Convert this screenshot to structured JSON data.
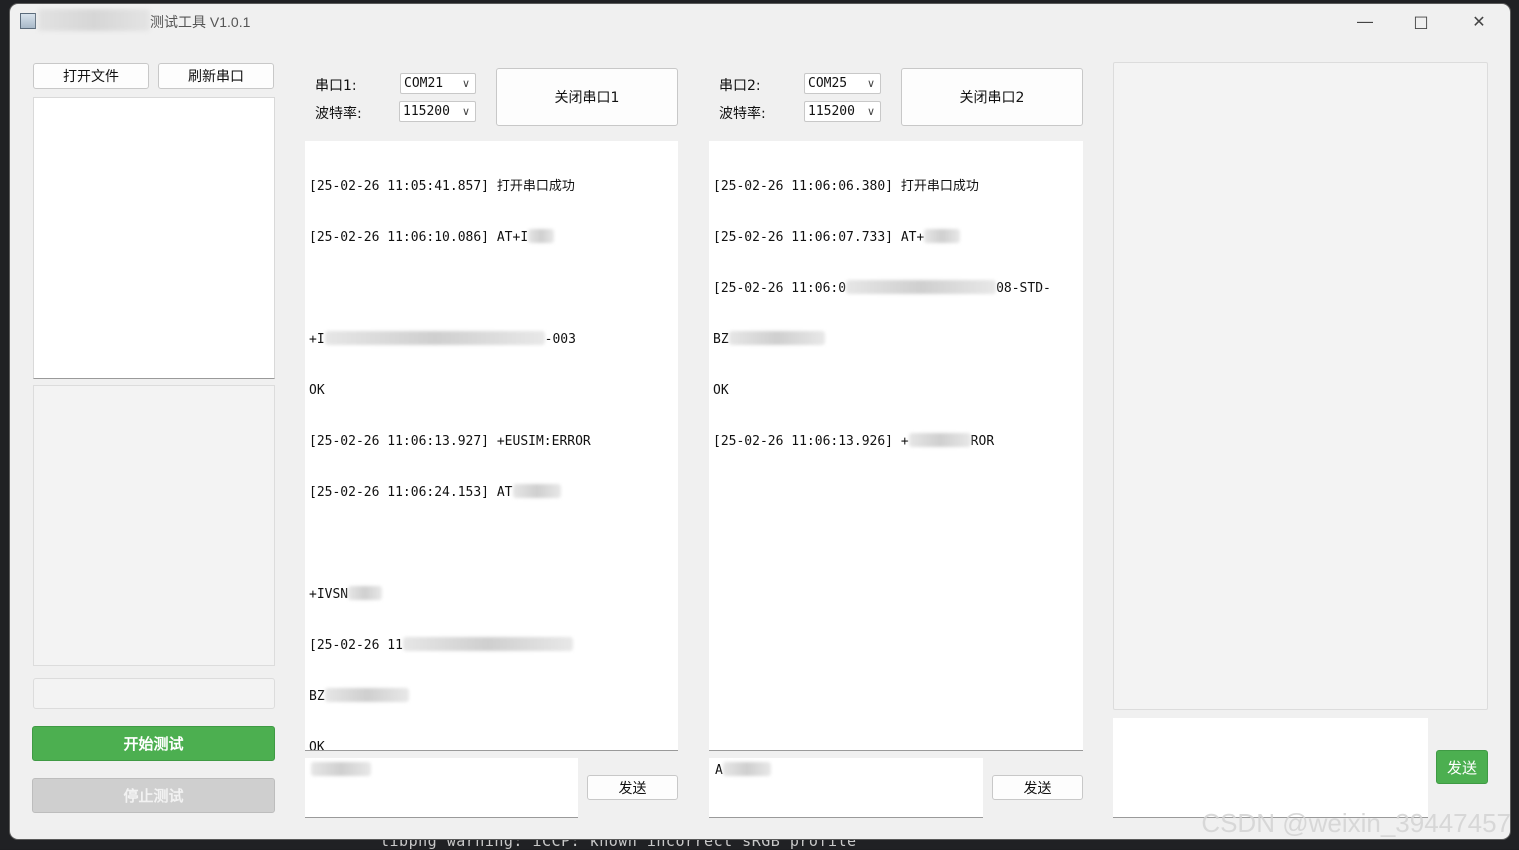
{
  "window": {
    "title": "测试工具 V1.0.1"
  },
  "left": {
    "open_file": "打开文件",
    "refresh_ports": "刷新串口",
    "start_test": "开始测试",
    "stop_test": "停止测试"
  },
  "port1": {
    "port_label": "串口1:",
    "baud_label": "波特率:",
    "port_value": "COM21",
    "baud_value": "115200",
    "close_button": "关闭串口1",
    "send_button": "发送",
    "log": [
      "[25-02-26 11:05:41.857] 打开串口成功",
      "[25-02-26 11:06:10.086] AT+I",
      "",
      "+I",
      "-003",
      "OK",
      "[25-02-26 11:06:13.927] +EUSIM:ERROR",
      "[25-02-26 11:06:24.153] AT",
      "",
      "+IVSN",
      "[25-02-26 11",
      "BZ",
      "OK"
    ]
  },
  "port2": {
    "port_label": "串口2:",
    "baud_label": "波特率:",
    "port_value": "COM25",
    "baud_value": "115200",
    "close_button": "关闭串口2",
    "send_button": "发送",
    "log": [
      "[25-02-26 11:06:06.380] 打开串口成功",
      "[25-02-26 11:06:07.733] AT+",
      "[25-02-26 11:06:0",
      "08-STD-",
      "BZ",
      "OK",
      "[25-02-26 11:06:13.926] +",
      "ROR"
    ],
    "input_prefix": "A"
  },
  "right": {
    "send_button": "发送"
  },
  "background": {
    "terminal_text": "libpng warning: iCCP: known incorrect sRGB profile",
    "watermark": "CSDN @weixin_39447457"
  },
  "colors": {
    "start_green": "#4caf50",
    "stop_grey": "#cfcfcf"
  }
}
